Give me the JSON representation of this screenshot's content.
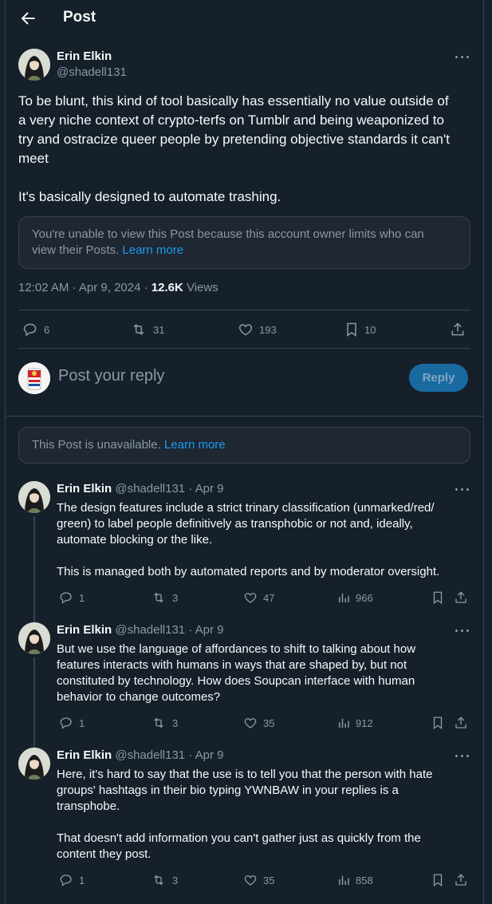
{
  "header": {
    "title": "Post"
  },
  "main_post": {
    "author_name": "Erin Elkin",
    "author_handle": "@shadell131",
    "text": "To be blunt, this kind of tool basically has essentially no value outside of\na very niche context of crypto-terfs on Tumblr and being weaponized to\ntry and ostracize queer people by pretending objective standards it can't\nmeet\n\nIt's basically designed to automate trashing.",
    "notice_text": "You're unable to view this Post because this account owner limits who can\nview their Posts.",
    "notice_link": "Learn more",
    "timestamp": "12:02 AM · Apr 9, 2024 · ",
    "views_count": "12.6K",
    "views_label": " Views",
    "actions": {
      "replies": "6",
      "reposts": "31",
      "likes": "193",
      "bookmarks": "10"
    }
  },
  "composer": {
    "placeholder": "Post your reply",
    "reply_button": "Reply"
  },
  "unavailable": {
    "text": "This Post is unavailable.",
    "link": "Learn more"
  },
  "replies": [
    {
      "name": "Erin Elkin",
      "handle": "@shadell131",
      "date": "Apr 9",
      "text": "The design features include a strict trinary classification (unmarked/red/\ngreen) to label people definitively as transphobic or not and, ideally,\nautomate blocking or the like.\n\nThis is managed both by automated reports and by moderator oversight.",
      "replies": "1",
      "reposts": "3",
      "likes": "47",
      "views": "966"
    },
    {
      "name": "Erin Elkin",
      "handle": "@shadell131",
      "date": "Apr 9",
      "text": "But we use the language of affordances to shift to talking about how\nfeatures interacts with humans in ways that are shaped by, but not\nconstituted by technology. How does Soupcan interface with human\nbehavior to change outcomes?",
      "replies": "1",
      "reposts": "3",
      "likes": "35",
      "views": "912"
    },
    {
      "name": "Erin Elkin",
      "handle": "@shadell131",
      "date": "Apr 9",
      "text": "Here, it's hard to say that the use is to tell you that the person with hate\ngroups' hashtags in their bio typing YWNBAW in your replies is a\ntransphobe.\n\nThat doesn't add information you can't gather just as quickly from the\ncontent they post.",
      "replies": "1",
      "reposts": "3",
      "likes": "35",
      "views": "858"
    }
  ],
  "colors": {
    "background": "#15202b",
    "accent": "#1d9bf0",
    "muted": "#8b98a5",
    "border": "#38444d"
  }
}
